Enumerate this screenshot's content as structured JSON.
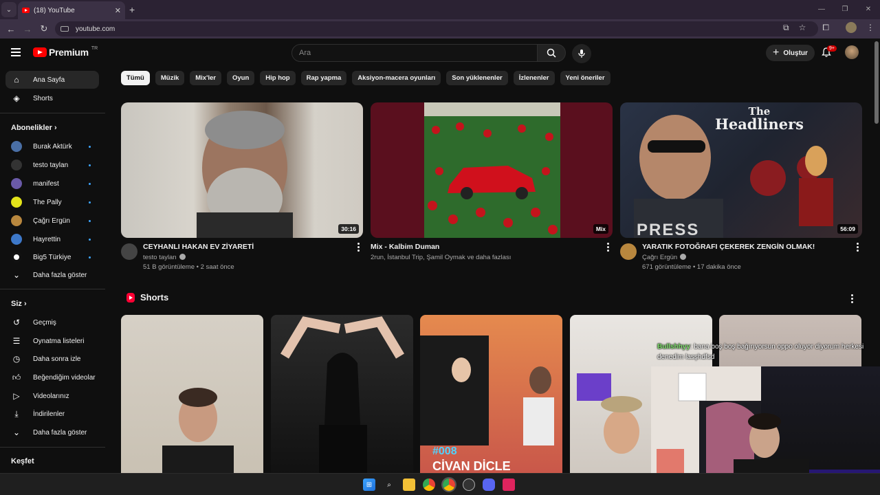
{
  "browser": {
    "tab_title": "(18) YouTube",
    "tab_close": "✕",
    "new_tab": "+",
    "url": "youtube.com"
  },
  "header": {
    "logo_text": "Premium",
    "logo_region": "TR",
    "search_placeholder": "Ara",
    "create_label": "Oluştur",
    "notification_count": "9+"
  },
  "sidebar": {
    "home": "Ana Sayfa",
    "shorts": "Shorts",
    "subscriptions_header": "Abonelikler",
    "subscriptions": [
      {
        "name": "Burak Aktürk",
        "color": "#4a6fa5"
      },
      {
        "name": "testo taylan",
        "color": "#222222"
      },
      {
        "name": "manifest",
        "color": "#6a5aa8"
      },
      {
        "name": "The Pally",
        "color": "#e3e31a"
      },
      {
        "name": "Çağrı Ergün",
        "color": "#b8873e"
      },
      {
        "name": "Hayrettin",
        "color": "#3d78c9"
      },
      {
        "name": "Big5 Türkiye",
        "color": "#ffffff"
      }
    ],
    "show_more": "Daha fazla göster",
    "you_header": "Siz",
    "you_items": [
      "Geçmiş",
      "Oynatma listeleri",
      "Daha sonra izle",
      "Beğendiğim videolar",
      "Videolarınız",
      "İndirilenler",
      "Daha fazla göster"
    ],
    "explore_header": "Keşfet"
  },
  "chips": [
    "Tümü",
    "Müzik",
    "Mix'ler",
    "Oyun",
    "Hip hop",
    "Rap yapma",
    "Aksiyon-macera oyunları",
    "Son yüklenenler",
    "İzlenenler",
    "Yeni öneriler"
  ],
  "videos": [
    {
      "title": "CEYHANLI HAKAN EV ZİYARETİ",
      "channel": "testo taylan",
      "stats": "51 B görüntüleme • 2 saat önce",
      "duration": "30:16"
    },
    {
      "title": "Mix - Kalbim Duman",
      "channel": "2run, İstanbul Trip, Şamil Oymak ve daha fazlası",
      "stats": "",
      "duration": "Mix"
    },
    {
      "title": "YARATIK FOTOĞRAFI ÇEKEREK ZENGİN OLMAK!",
      "channel": "Çağrı Ergün",
      "stats": "671 görüntüleme • 17 dakika önce",
      "duration": "56:09",
      "thumb_text_1": "The",
      "thumb_text_2": "Headliners",
      "thumb_text_3": "PRESS"
    }
  ],
  "shorts": {
    "title": "Shorts",
    "items": [
      {
        "label": ""
      },
      {
        "label": ""
      },
      {
        "label": "#008"
      },
      {
        "label": ""
      },
      {
        "label": ""
      }
    ],
    "short3_caption": "CİVAN DİCLE"
  },
  "overlay": {
    "chat_user": "Bullshhyy",
    "chat_message": ": bana boş boş bağırıyorsun oppo oluyor diyorum herkesi denedim lasşhdfsd"
  }
}
